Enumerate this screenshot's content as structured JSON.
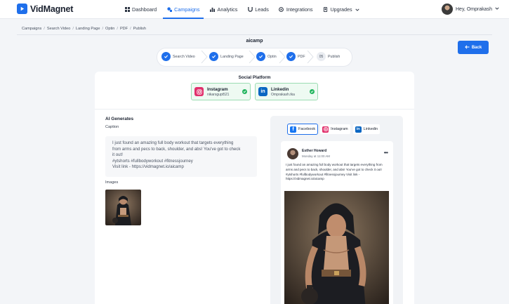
{
  "app": {
    "name": "VidMagnet"
  },
  "nav": {
    "items": [
      {
        "label": "Dashboard",
        "icon": "dashboard-icon"
      },
      {
        "label": "Campaigns",
        "icon": "campaigns-icon",
        "active": true
      },
      {
        "label": "Analytics",
        "icon": "analytics-icon"
      },
      {
        "label": "Leads",
        "icon": "leads-icon"
      },
      {
        "label": "Integrations",
        "icon": "integrations-icon"
      },
      {
        "label": "Upgrades",
        "icon": "upgrades-icon"
      }
    ],
    "user_greeting": "Hey, Omprakash"
  },
  "breadcrumb": [
    "Campaigns",
    "Search Video",
    "Landing Page",
    "Optin",
    "PDF",
    "Publish"
  ],
  "page": {
    "title": "aicamp",
    "back_label": "Back"
  },
  "stepper": {
    "steps": [
      {
        "label": "Search Video",
        "done": true
      },
      {
        "label": "Landing Page",
        "done": true
      },
      {
        "label": "Optin",
        "done": true
      },
      {
        "label": "PDF",
        "done": true
      },
      {
        "label": "Publish",
        "number": "05",
        "done": false
      }
    ]
  },
  "social_platform": {
    "title": "Social Platform",
    "accounts": [
      {
        "name": "Instagram",
        "handle": "nikarsgupt521",
        "icon": "instagram-icon"
      },
      {
        "name": "Linkedin",
        "handle": "Omprakash.tka",
        "icon": "linkedin-icon"
      }
    ]
  },
  "ai": {
    "title": "AI Generates",
    "caption_label": "Caption",
    "caption_lines": [
      "I just found an amazing full body workout that targets everything",
      "from arms and pecs to back, shoulder, and abs! You've got to check",
      "it out!",
      "#ytshorts #fullbodyworkout #fitnessjourney",
      "Visit link - https://vidmagnet.io/aicamp"
    ],
    "images_label": "Images"
  },
  "preview": {
    "tabs": [
      {
        "label": "Facebook",
        "icon": "facebook-icon",
        "active": true
      },
      {
        "label": "Instagram",
        "icon": "instagram-icon"
      },
      {
        "label": "Linkedin",
        "icon": "linkedin-icon"
      }
    ],
    "post": {
      "author": "Esther Howard",
      "time": "Monday at 11:00 AM",
      "text": "I just found an amazing full body workout that targets everything from arms and pecs to back, shoulder, and abs! You've got to check it out! #ytshorts #fullbodyworkout #fitnessjourney Visit link - https://vidmagnet.io/aicamp",
      "more_label": "•••"
    }
  },
  "colors": {
    "primary": "#1f6feb",
    "success": "#22b45e",
    "instagram": "#e1306c",
    "linkedin": "#0a66c2",
    "facebook": "#1877f2"
  }
}
